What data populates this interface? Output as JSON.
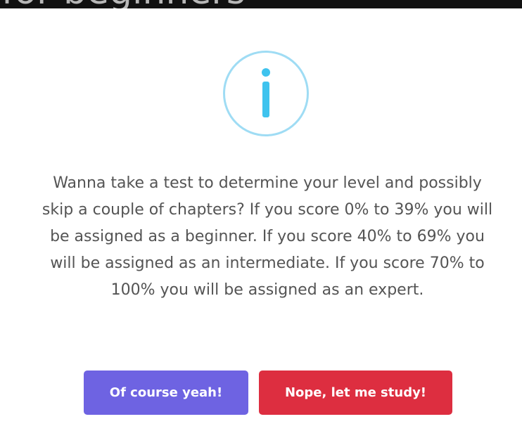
{
  "backdrop": {
    "heading_fragment": "for beginners"
  },
  "dialog": {
    "icon": "info-icon",
    "icon_color": "#3fc3ee",
    "icon_ring_color": "#9fdcf4",
    "message": "Wanna take a test to determine your level and possibly skip a couple of chapters? If you score 0% to 39% you will be assigned as a beginner. If you score 40% to 69% you will be assigned as an intermediate. If you score 70% to 100% you will be assigned as an expert.",
    "confirm_label": "Of course yeah!",
    "deny_label": "Nope, let me study!",
    "confirm_color": "#6e63e2",
    "deny_color": "#dd2e40"
  }
}
